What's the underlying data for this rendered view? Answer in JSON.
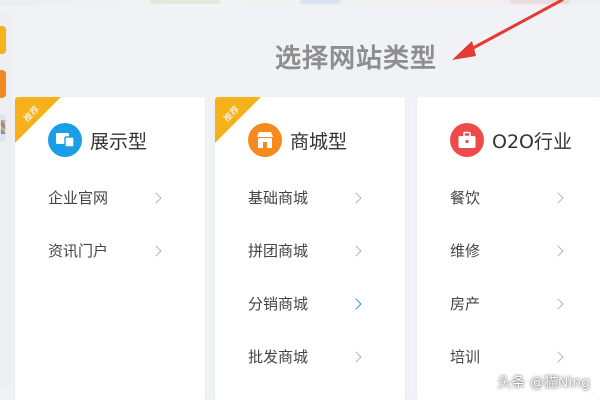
{
  "page": {
    "title": "选择网站类型"
  },
  "colors": {
    "ribbon": "#f6b21b",
    "display_icon": "#1a9ee8",
    "mall_icon": "#f58a1f",
    "o2o_icon": "#ee4a4a",
    "arrow": "#e53935",
    "active_chevron": "#3a8fe8"
  },
  "cards": [
    {
      "ribbon": "推荐",
      "icon": "display-screen-icon",
      "title": "展示型",
      "items": [
        {
          "label": "企业官网"
        },
        {
          "label": "资讯门户"
        }
      ]
    },
    {
      "ribbon": "推荐",
      "icon": "shop-store-icon",
      "title": "商城型",
      "items": [
        {
          "label": "基础商城"
        },
        {
          "label": "拼团商城"
        },
        {
          "label": "分销商城",
          "active": true
        },
        {
          "label": "批发商城"
        }
      ]
    },
    {
      "icon": "briefcase-icon",
      "title": "O2O行业",
      "items": [
        {
          "label": "餐饮"
        },
        {
          "label": "维修"
        },
        {
          "label": "房产"
        },
        {
          "label": "培训"
        }
      ]
    }
  ],
  "watermark": "头条 @猫Ning"
}
